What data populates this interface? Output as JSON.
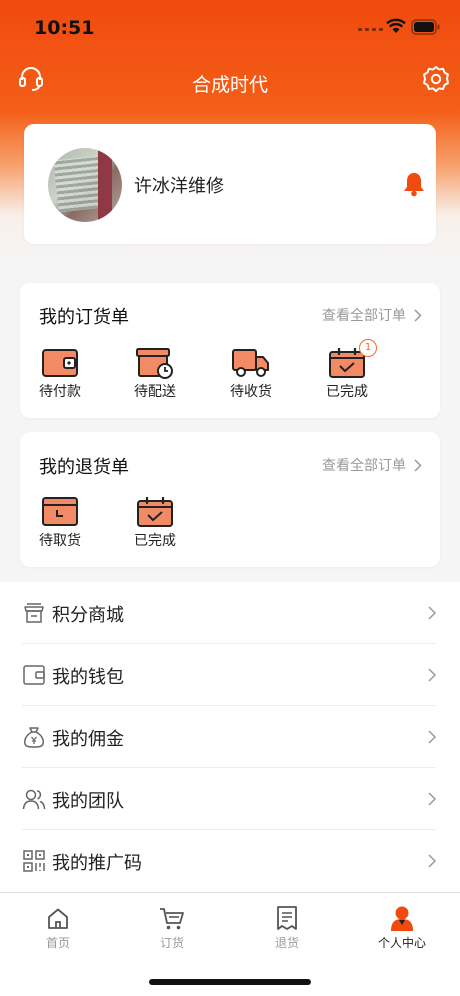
{
  "status": {
    "time": "10:51"
  },
  "header": {
    "title": "合成时代"
  },
  "profile": {
    "name": "许冰洋维修"
  },
  "orders": {
    "title": "我的订货单",
    "see_all": "查看全部订单",
    "items": [
      {
        "label": "待付款",
        "icon": "wallet-icon"
      },
      {
        "label": "待配送",
        "icon": "delivery-box-icon"
      },
      {
        "label": "待收货",
        "icon": "truck-icon"
      },
      {
        "label": "已完成",
        "icon": "calendar-check-icon",
        "badge": "1"
      }
    ]
  },
  "returns": {
    "title": "我的退货单",
    "see_all": "查看全部订单",
    "items": [
      {
        "label": "待取货",
        "icon": "pickup-box-icon"
      },
      {
        "label": "已完成",
        "icon": "calendar-check-icon"
      }
    ]
  },
  "menu": [
    {
      "label": "积分商城",
      "icon": "store-icon"
    },
    {
      "label": "我的钱包",
      "icon": "wallet-outline-icon"
    },
    {
      "label": "我的佣金",
      "icon": "money-bag-icon"
    },
    {
      "label": "我的团队",
      "icon": "team-icon"
    },
    {
      "label": "我的推广码",
      "icon": "qr-code-icon"
    }
  ],
  "tabs": [
    {
      "label": "首页",
      "icon": "home-icon"
    },
    {
      "label": "订货",
      "icon": "cart-icon"
    },
    {
      "label": "退货",
      "icon": "return-doc-icon"
    },
    {
      "label": "个人中心",
      "icon": "person-icon",
      "active": true
    }
  ],
  "colors": {
    "accent": "#F04A0F",
    "icon_fill": "#F28A66",
    "text_muted": "#9A9A9A"
  }
}
